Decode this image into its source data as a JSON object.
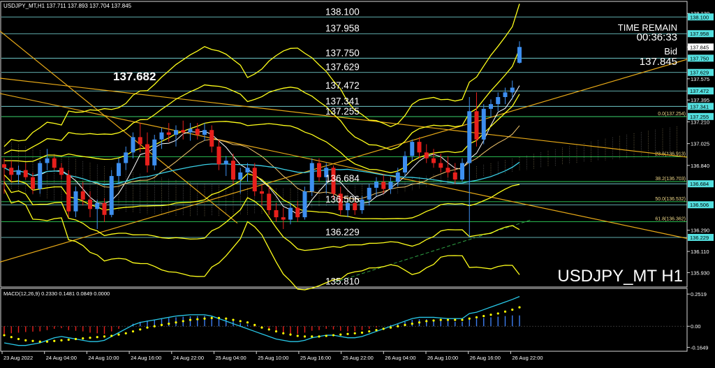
{
  "header": {
    "symbol_info": "USDJPY_MT,H1  137.711 137.893 137.704 137.845",
    "time_remain_label": "TIME REMAIN",
    "time_remain_value": "00:36:33",
    "bid_label": "Bid",
    "bid_value": "137.845",
    "watermark": "USDJPY_MT H1",
    "highlight_level": "137.682"
  },
  "colors": {
    "background": "#000000",
    "bull_candle": "#3d8ff0",
    "bear_candle": "#e8201c",
    "bollinger": "#ffff1a",
    "trendline": "#e6a817",
    "level_line": "#7fe7e7",
    "fib_line": "#2fd05a",
    "ma_fast": "#ffffff",
    "ma_mid": "#f2c66b",
    "ma_slow": "#3ad0e6",
    "macd_line": "#28c8e8",
    "macd_signal": "#ffff00"
  },
  "chart_data": [
    {
      "type": "candlestick",
      "symbol": "USDJPY_MT",
      "timeframe": "H1",
      "ylim": [
        135.82,
        138.22
      ],
      "y_ticks": [
        "138.130",
        "137.845",
        "137.575",
        "137.395",
        "137.210",
        "137.025",
        "136.840",
        "136.290",
        "136.110",
        "135.930"
      ],
      "x_ticks": [
        "23 Aug 2022",
        "24 Aug 04:00",
        "24 Aug 10:00",
        "24 Aug 16:00",
        "24 Aug 22:00",
        "25 Aug 04:00",
        "25 Aug 10:00",
        "25 Aug 16:00",
        "25 Aug 22:00",
        "26 Aug 04:00",
        "26 Aug 10:00",
        "26 Aug 16:00",
        "26 Aug 22:00"
      ],
      "candles": [
        {
          "o": 136.85,
          "h": 136.9,
          "l": 136.6,
          "c": 136.82
        },
        {
          "o": 136.82,
          "h": 136.88,
          "l": 136.7,
          "c": 136.76
        },
        {
          "o": 136.76,
          "h": 136.84,
          "l": 136.68,
          "c": 136.8
        },
        {
          "o": 136.8,
          "h": 136.86,
          "l": 136.72,
          "c": 136.74
        },
        {
          "o": 136.74,
          "h": 136.78,
          "l": 136.6,
          "c": 136.64
        },
        {
          "o": 136.64,
          "h": 136.88,
          "l": 136.6,
          "c": 136.86
        },
        {
          "o": 136.86,
          "h": 136.98,
          "l": 136.8,
          "c": 136.9
        },
        {
          "o": 136.9,
          "h": 136.92,
          "l": 136.8,
          "c": 136.82
        },
        {
          "o": 136.82,
          "h": 136.86,
          "l": 136.72,
          "c": 136.76
        },
        {
          "o": 136.76,
          "h": 136.8,
          "l": 136.4,
          "c": 136.45
        },
        {
          "o": 136.45,
          "h": 136.66,
          "l": 136.4,
          "c": 136.62
        },
        {
          "o": 136.62,
          "h": 136.7,
          "l": 136.5,
          "c": 136.55
        },
        {
          "o": 136.55,
          "h": 136.62,
          "l": 136.4,
          "c": 136.47
        },
        {
          "o": 136.47,
          "h": 136.55,
          "l": 136.3,
          "c": 136.52
        },
        {
          "o": 136.52,
          "h": 136.56,
          "l": 136.36,
          "c": 136.42
        },
        {
          "o": 136.42,
          "h": 136.8,
          "l": 136.4,
          "c": 136.75
        },
        {
          "o": 136.75,
          "h": 136.9,
          "l": 136.68,
          "c": 136.86
        },
        {
          "o": 136.86,
          "h": 137.0,
          "l": 136.8,
          "c": 136.95
        },
        {
          "o": 136.95,
          "h": 137.12,
          "l": 136.9,
          "c": 137.08
        },
        {
          "o": 137.08,
          "h": 137.2,
          "l": 136.95,
          "c": 137.02
        },
        {
          "o": 137.02,
          "h": 137.12,
          "l": 136.78,
          "c": 136.84
        },
        {
          "o": 136.84,
          "h": 137.1,
          "l": 136.8,
          "c": 137.06
        },
        {
          "o": 137.06,
          "h": 137.16,
          "l": 136.98,
          "c": 137.12
        },
        {
          "o": 137.12,
          "h": 137.2,
          "l": 137.04,
          "c": 137.1
        },
        {
          "o": 137.1,
          "h": 137.18,
          "l": 137.0,
          "c": 137.14
        },
        {
          "o": 137.14,
          "h": 137.22,
          "l": 137.06,
          "c": 137.12
        },
        {
          "o": 137.12,
          "h": 137.2,
          "l": 137.05,
          "c": 137.15
        },
        {
          "o": 137.15,
          "h": 137.2,
          "l": 137.06,
          "c": 137.1
        },
        {
          "o": 137.1,
          "h": 137.2,
          "l": 137.05,
          "c": 137.14
        },
        {
          "o": 137.14,
          "h": 137.18,
          "l": 136.95,
          "c": 137.0
        },
        {
          "o": 137.0,
          "h": 137.06,
          "l": 136.8,
          "c": 136.85
        },
        {
          "o": 136.85,
          "h": 136.92,
          "l": 136.75,
          "c": 136.88
        },
        {
          "o": 136.88,
          "h": 136.94,
          "l": 136.68,
          "c": 136.72
        },
        {
          "o": 136.72,
          "h": 136.82,
          "l": 136.6,
          "c": 136.78
        },
        {
          "o": 136.78,
          "h": 136.86,
          "l": 136.7,
          "c": 136.82
        },
        {
          "o": 136.82,
          "h": 136.86,
          "l": 136.58,
          "c": 136.62
        },
        {
          "o": 136.62,
          "h": 136.68,
          "l": 136.5,
          "c": 136.6
        },
        {
          "o": 136.6,
          "h": 136.66,
          "l": 136.42,
          "c": 136.46
        },
        {
          "o": 136.46,
          "h": 136.52,
          "l": 136.36,
          "c": 136.4
        },
        {
          "o": 136.4,
          "h": 136.48,
          "l": 136.3,
          "c": 136.38
        },
        {
          "o": 136.38,
          "h": 136.52,
          "l": 136.34,
          "c": 136.48
        },
        {
          "o": 136.48,
          "h": 136.54,
          "l": 136.36,
          "c": 136.4
        },
        {
          "o": 136.4,
          "h": 136.66,
          "l": 136.38,
          "c": 136.62
        },
        {
          "o": 136.62,
          "h": 136.9,
          "l": 136.58,
          "c": 136.86
        },
        {
          "o": 136.86,
          "h": 136.9,
          "l": 136.7,
          "c": 136.74
        },
        {
          "o": 136.74,
          "h": 136.86,
          "l": 136.6,
          "c": 136.82
        },
        {
          "o": 136.82,
          "h": 136.84,
          "l": 136.56,
          "c": 136.6
        },
        {
          "o": 136.6,
          "h": 136.66,
          "l": 136.42,
          "c": 136.46
        },
        {
          "o": 136.46,
          "h": 136.56,
          "l": 136.4,
          "c": 136.52
        },
        {
          "o": 136.52,
          "h": 136.56,
          "l": 136.42,
          "c": 136.46
        },
        {
          "o": 136.46,
          "h": 136.58,
          "l": 136.43,
          "c": 136.55
        },
        {
          "o": 136.55,
          "h": 136.68,
          "l": 136.5,
          "c": 136.65
        },
        {
          "o": 136.65,
          "h": 136.74,
          "l": 136.58,
          "c": 136.7
        },
        {
          "o": 136.7,
          "h": 136.76,
          "l": 136.6,
          "c": 136.64
        },
        {
          "o": 136.64,
          "h": 136.74,
          "l": 136.6,
          "c": 136.7
        },
        {
          "o": 136.7,
          "h": 136.82,
          "l": 136.66,
          "c": 136.78
        },
        {
          "o": 136.78,
          "h": 136.96,
          "l": 136.74,
          "c": 136.92
        },
        {
          "o": 136.92,
          "h": 137.06,
          "l": 136.88,
          "c": 137.04
        },
        {
          "o": 137.04,
          "h": 137.08,
          "l": 136.9,
          "c": 136.95
        },
        {
          "o": 136.95,
          "h": 137.02,
          "l": 136.86,
          "c": 136.9
        },
        {
          "o": 136.9,
          "h": 136.98,
          "l": 136.82,
          "c": 136.86
        },
        {
          "o": 136.86,
          "h": 136.94,
          "l": 136.78,
          "c": 136.82
        },
        {
          "o": 136.82,
          "h": 136.92,
          "l": 136.74,
          "c": 136.78
        },
        {
          "o": 136.78,
          "h": 136.86,
          "l": 136.68,
          "c": 136.72
        },
        {
          "o": 136.72,
          "h": 136.9,
          "l": 136.7,
          "c": 136.86
        },
        {
          "o": 136.86,
          "h": 137.42,
          "l": 136.23,
          "c": 137.3
        },
        {
          "o": 137.3,
          "h": 137.46,
          "l": 137.0,
          "c": 137.06
        },
        {
          "o": 137.06,
          "h": 137.36,
          "l": 137.02,
          "c": 137.32
        },
        {
          "o": 137.32,
          "h": 137.4,
          "l": 137.25,
          "c": 137.36
        },
        {
          "o": 137.36,
          "h": 137.46,
          "l": 137.3,
          "c": 137.42
        },
        {
          "o": 137.42,
          "h": 137.5,
          "l": 137.36,
          "c": 137.46
        },
        {
          "o": 137.46,
          "h": 137.56,
          "l": 137.4,
          "c": 137.5
        },
        {
          "o": 137.711,
          "h": 137.893,
          "l": 137.704,
          "c": 137.845
        }
      ],
      "horizontal_levels": [
        {
          "value": 138.1,
          "label": "138.100"
        },
        {
          "value": 137.958,
          "label": "137.958"
        },
        {
          "value": 137.75,
          "label": "137.750"
        },
        {
          "value": 137.629,
          "label": "137.629"
        },
        {
          "value": 137.472,
          "label": "137.472"
        },
        {
          "value": 137.341,
          "label": "137.341"
        },
        {
          "value": 137.255,
          "label": "137.255"
        },
        {
          "value": 136.684,
          "label": "136.684"
        },
        {
          "value": 136.506,
          "label": "136.506"
        },
        {
          "value": 136.229,
          "label": "136.229"
        },
        {
          "value": 135.81,
          "label": "135.810"
        }
      ],
      "fib_levels": [
        {
          "value": 137.254,
          "label": "0.0(137.254)"
        },
        {
          "value": 136.913,
          "label": "23.6(136.913)"
        },
        {
          "value": 136.703,
          "label": "38.2(136.703)"
        },
        {
          "value": 136.532,
          "label": "50.0(136.532)"
        },
        {
          "value": 136.362,
          "label": "61.8(136.362)"
        }
      ],
      "price_tags": [
        "138.100",
        "137.958",
        "137.750",
        "137.629",
        "137.472",
        "137.341",
        "137.255",
        "136.684",
        "136.506",
        "136.229"
      ],
      "current_price": {
        "value": 137.845,
        "label": "137.845"
      }
    },
    {
      "type": "bar",
      "title": "MACD(12,26,9) 0.2330 0.1481 0.0849 0.0000",
      "ylim": [
        -0.19,
        0.28
      ],
      "y_ticks": [
        "0.2519",
        "0.00",
        "-0.1649"
      ],
      "histogram": [
        -0.06,
        -0.055,
        -0.05,
        -0.045,
        -0.042,
        -0.04,
        -0.03,
        -0.02,
        -0.015,
        -0.03,
        -0.035,
        -0.04,
        -0.05,
        -0.055,
        -0.06,
        -0.04,
        -0.02,
        0.0,
        0.02,
        0.035,
        0.045,
        0.05,
        0.06,
        0.065,
        0.07,
        0.075,
        0.078,
        0.08,
        0.082,
        0.078,
        0.06,
        0.05,
        0.04,
        0.025,
        0.015,
        -0.005,
        -0.015,
        -0.03,
        -0.045,
        -0.055,
        -0.06,
        -0.06,
        -0.05,
        -0.035,
        -0.03,
        -0.02,
        -0.025,
        -0.035,
        -0.04,
        -0.04,
        -0.03,
        -0.02,
        -0.01,
        0.0,
        0.01,
        0.02,
        0.035,
        0.05,
        0.055,
        0.055,
        0.05,
        0.045,
        0.04,
        0.035,
        0.035,
        0.06,
        0.06,
        0.065,
        0.07,
        0.075,
        0.08,
        0.085,
        0.0849
      ],
      "macd_line": [
        -0.13,
        -0.14,
        -0.15,
        -0.15,
        -0.14,
        -0.13,
        -0.11,
        -0.09,
        -0.08,
        -0.09,
        -0.1,
        -0.11,
        -0.12,
        -0.12,
        -0.11,
        -0.08,
        -0.05,
        -0.02,
        0.01,
        0.03,
        0.04,
        0.05,
        0.06,
        0.07,
        0.08,
        0.085,
        0.09,
        0.09,
        0.09,
        0.08,
        0.06,
        0.04,
        0.02,
        0.0,
        -0.02,
        -0.04,
        -0.06,
        -0.08,
        -0.1,
        -0.11,
        -0.12,
        -0.12,
        -0.11,
        -0.09,
        -0.08,
        -0.07,
        -0.07,
        -0.08,
        -0.09,
        -0.09,
        -0.08,
        -0.06,
        -0.04,
        -0.02,
        0.0,
        0.02,
        0.04,
        0.06,
        0.07,
        0.07,
        0.07,
        0.065,
        0.06,
        0.06,
        0.06,
        0.1,
        0.11,
        0.13,
        0.15,
        0.17,
        0.19,
        0.21,
        0.233
      ],
      "signal_line": [
        -0.07,
        -0.085,
        -0.1,
        -0.11,
        -0.115,
        -0.12,
        -0.12,
        -0.115,
        -0.11,
        -0.105,
        -0.1,
        -0.095,
        -0.09,
        -0.085,
        -0.08,
        -0.075,
        -0.065,
        -0.055,
        -0.04,
        -0.025,
        -0.01,
        0.0,
        0.01,
        0.02,
        0.03,
        0.04,
        0.05,
        0.055,
        0.06,
        0.065,
        0.065,
        0.06,
        0.05,
        0.04,
        0.03,
        0.01,
        -0.01,
        -0.025,
        -0.04,
        -0.055,
        -0.065,
        -0.075,
        -0.08,
        -0.08,
        -0.08,
        -0.075,
        -0.07,
        -0.065,
        -0.06,
        -0.055,
        -0.05,
        -0.04,
        -0.03,
        -0.02,
        -0.01,
        0.0,
        0.01,
        0.02,
        0.03,
        0.04,
        0.045,
        0.05,
        0.05,
        0.05,
        0.05,
        0.06,
        0.07,
        0.08,
        0.09,
        0.1,
        0.115,
        0.13,
        0.1481
      ]
    }
  ]
}
